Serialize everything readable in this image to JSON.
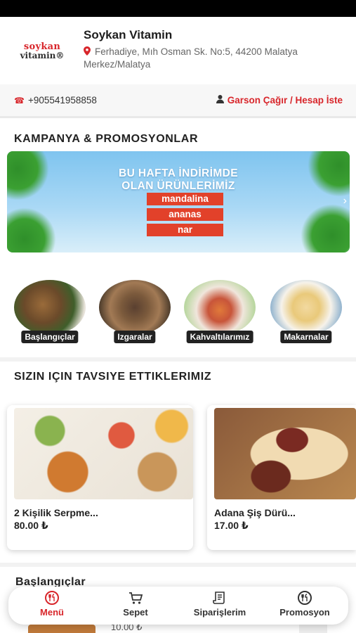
{
  "header": {
    "logo_line1": "soykan",
    "logo_line2": "vitamin®",
    "store_name": "Soykan Vitamin",
    "address": "Ferhadiye, Mıh Osman Sk. No:5, 44200 Malatya Merkez/Malatya",
    "pin_icon": "location-pin-icon"
  },
  "contact": {
    "phone": "+905541958858",
    "phone_icon": "phone-icon",
    "waiter_label": "Garson Çağır / Hesap İste",
    "waiter_icon": "waiter-icon"
  },
  "campaign": {
    "title": "KAMPANYA & PROMOSYONLAR",
    "banner_heading_line1": "BU HAFTA İNDİRİMDE",
    "banner_heading_line2": "OLAN ÜRÜNLERİMİZ",
    "banner_items": [
      "mandalina",
      "ananas",
      "nar"
    ]
  },
  "categories": [
    {
      "label": "Başlangıçlar"
    },
    {
      "label": "Izgaralar"
    },
    {
      "label": "Kahvaltılarımız"
    },
    {
      "label": "Makarnalar"
    }
  ],
  "recommended": {
    "title": "SIZIN IÇIN TAVSIYE ETTIKLERIMIZ",
    "items": [
      {
        "name": "2 Kişilik Serpme...",
        "price": "80.00 ₺"
      },
      {
        "name": "Adana Şiş Dürü...",
        "price": "17.00 ₺"
      }
    ]
  },
  "section_peek": {
    "title": "Başlangıçlar",
    "price": "10.00 ₺"
  },
  "bottom_nav": [
    {
      "label": "Menü",
      "icon": "menu-icon",
      "active": true
    },
    {
      "label": "Sepet",
      "icon": "cart-icon",
      "active": false
    },
    {
      "label": "Siparişlerim",
      "icon": "orders-icon",
      "active": false
    },
    {
      "label": "Promosyon",
      "icon": "promotion-icon",
      "active": false
    }
  ],
  "colors": {
    "accent": "#d8262b",
    "banner_tag": "#e2412a"
  }
}
